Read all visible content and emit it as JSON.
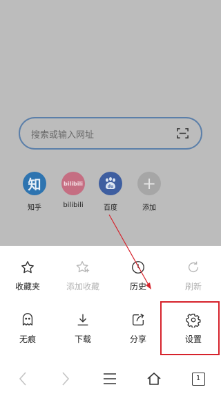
{
  "search": {
    "placeholder": "搜索或输入网址"
  },
  "quick_sites": [
    {
      "label": "知乎",
      "glyph": "知"
    },
    {
      "label": "bilibili",
      "glyph": "bilibili"
    },
    {
      "label": "百度",
      "glyph": "du"
    },
    {
      "label": "添加",
      "glyph": "+"
    }
  ],
  "menu": {
    "row1": [
      {
        "label": "收藏夹",
        "icon": "star-icon",
        "enabled": true
      },
      {
        "label": "添加收藏",
        "icon": "star-add-icon",
        "enabled": false
      },
      {
        "label": "历史",
        "icon": "clock-icon",
        "enabled": true
      },
      {
        "label": "刷新",
        "icon": "refresh-icon",
        "enabled": false
      }
    ],
    "row2": [
      {
        "label": "无痕",
        "icon": "ghost-icon",
        "enabled": true
      },
      {
        "label": "下载",
        "icon": "download-icon",
        "enabled": true
      },
      {
        "label": "分享",
        "icon": "share-icon",
        "enabled": true
      },
      {
        "label": "设置",
        "icon": "gear-icon",
        "enabled": true
      }
    ]
  },
  "nav": {
    "tab_count": "1"
  },
  "colors": {
    "highlight": "#d6222b",
    "arrow": "#d6222b"
  }
}
